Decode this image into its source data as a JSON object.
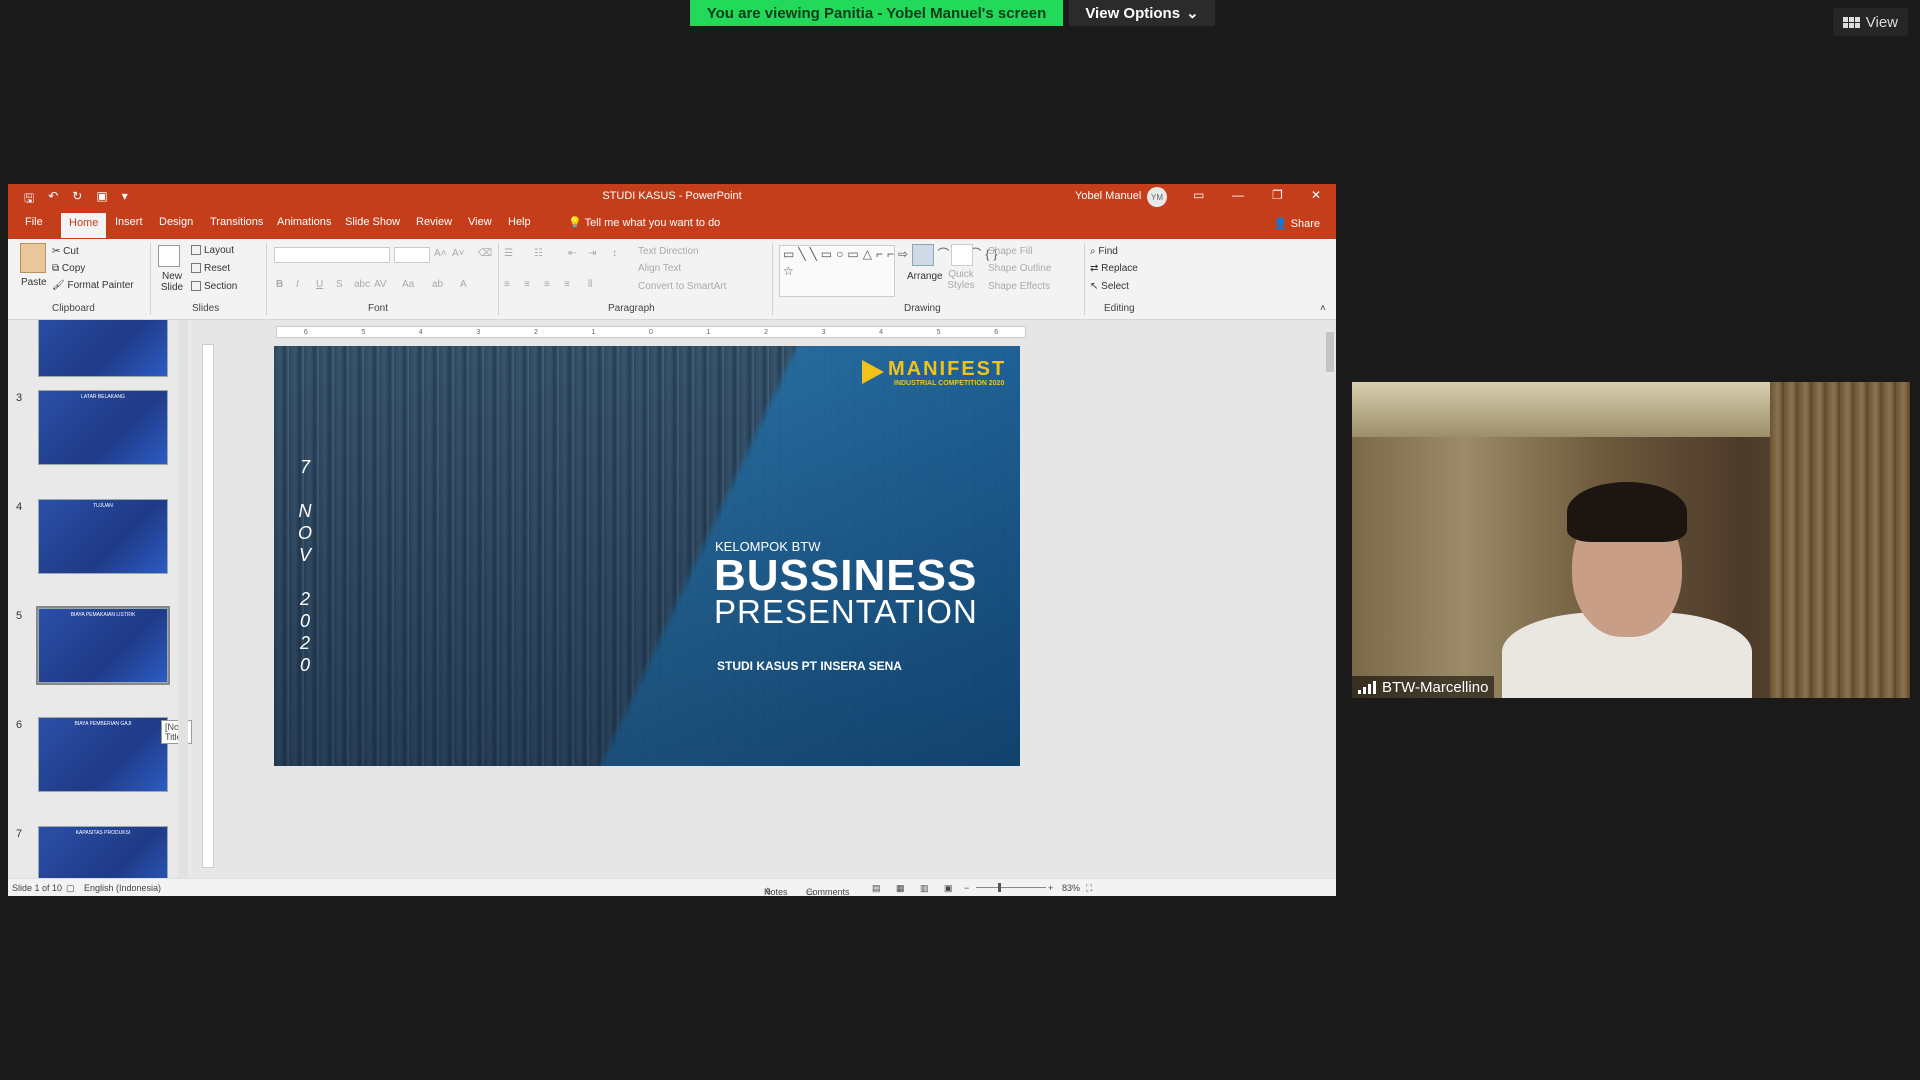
{
  "zoom": {
    "banner": "You are viewing Panitia - Yobel Manuel's screen",
    "view_options": "View Options",
    "view_button": "View",
    "webcam_name": "BTW-Marcellino",
    "colors": {
      "banner": "#23d959"
    }
  },
  "ppt": {
    "doc_title": "STUDI KASUS - PowerPoint",
    "user": "Yobel Manuel",
    "initials": "YM",
    "tabs": [
      "File",
      "Home",
      "Insert",
      "Design",
      "Transitions",
      "Animations",
      "Slide Show",
      "Review",
      "View",
      "Help"
    ],
    "active_tab": "Home",
    "tell_me": "Tell me what you want to do",
    "share": "Share",
    "ribbon": {
      "clipboard": {
        "label": "Clipboard",
        "paste": "Paste",
        "cut": "Cut",
        "copy": "Copy",
        "format_painter": "Format Painter"
      },
      "slides": {
        "label": "Slides",
        "new_slide": "New Slide",
        "layout": "Layout",
        "reset": "Reset",
        "section": "Section"
      },
      "font": {
        "label": "Font"
      },
      "paragraph": {
        "label": "Paragraph",
        "text_direction": "Text Direction",
        "align_text": "Align Text",
        "convert_smartart": "Convert to SmartArt"
      },
      "drawing": {
        "label": "Drawing",
        "arrange": "Arrange",
        "quick_styles": "Quick Styles",
        "shape_fill": "Shape Fill",
        "shape_outline": "Shape Outline",
        "shape_effects": "Shape Effects"
      },
      "editing": {
        "label": "Editing",
        "find": "Find",
        "replace": "Replace",
        "select": "Select"
      }
    },
    "thumbnails": [
      {
        "num": "",
        "title": ""
      },
      {
        "num": "3",
        "title": "LATAR BELAKANG"
      },
      {
        "num": "4",
        "title": "TUJUAN"
      },
      {
        "num": "5",
        "title": "BIAYA PEMAKAIAN LISTRIK"
      },
      {
        "num": "6",
        "title": "BIAYA PEMBERIAN GAJI"
      },
      {
        "num": "7",
        "title": "KAPASITAS PRODUKSI"
      }
    ],
    "tooltip": "[No Title]",
    "slide": {
      "date_chars": [
        "7",
        "N",
        "O",
        "V",
        "2",
        "0",
        "2",
        "0"
      ],
      "logo": "MANIFEST",
      "logo_sub": "INDUSTRIAL COMPETITION 2020",
      "kelompok": "KELOMPOK BTW",
      "title1": "BUSSINESS",
      "title2": "PRESENTATION",
      "subtitle": "STUDI KASUS PT INSERA SENA"
    },
    "status": {
      "slide_of": "Slide 1 of 10",
      "language": "English (Indonesia)",
      "notes": "Notes",
      "comments": "Comments",
      "zoom": "83%"
    }
  }
}
